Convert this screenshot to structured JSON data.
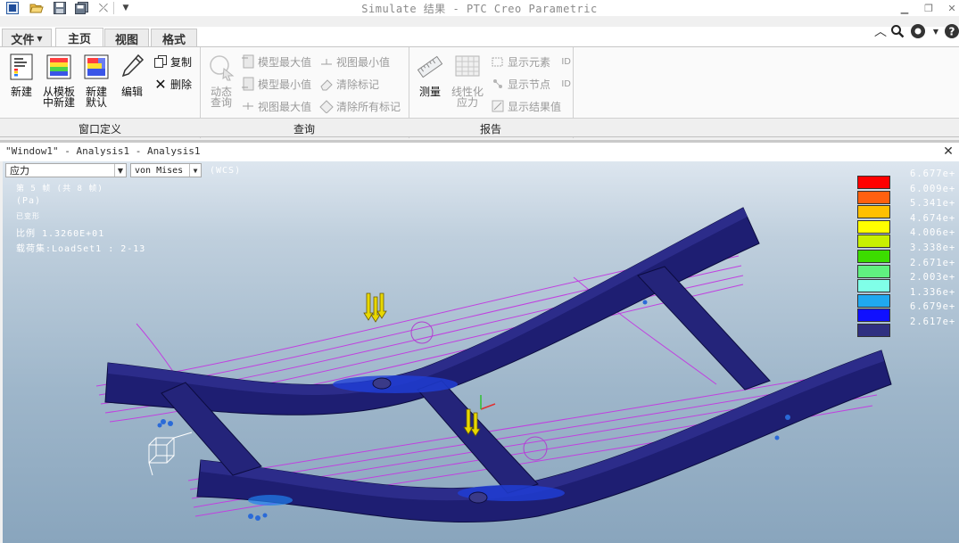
{
  "window": {
    "title": "Simulate 结果 - PTC Creo Parametric"
  },
  "tabs": [
    {
      "label": "文件"
    },
    {
      "label": "主页"
    },
    {
      "label": "视图"
    },
    {
      "label": "格式"
    }
  ],
  "ribbon": {
    "groups": [
      {
        "label": "窗口定义"
      },
      {
        "label": "查询"
      },
      {
        "label": "报告"
      }
    ],
    "window_def": {
      "new_label": "新建",
      "from_template_line1": "从模板",
      "from_template_line2": "中新建",
      "new_default_line1": "新建",
      "new_default_line2": "默认",
      "edit_label": "编辑",
      "copy_label": "复制",
      "delete_label": "删除"
    },
    "query": {
      "dynamic_line1": "动态",
      "dynamic_line2": "查询",
      "model_max": "模型最大值",
      "model_min": "模型最小值",
      "view_max": "视图最大值",
      "view_min": "视图最小值",
      "clear_mark": "清除标记",
      "clear_all_marks": "清除所有标记"
    },
    "report": {
      "measure_label": "测量",
      "linearize_line1": "线性化",
      "linearize_line2": "应力",
      "show_element": "显示元素",
      "show_node": "显示节点",
      "show_result": "显示结果值",
      "id_label": "ID"
    }
  },
  "analysis_window": {
    "title": "\"Window1\" - Analysis1 - Analysis1",
    "quantity_select": "应力",
    "component_select": "von Mises",
    "coord_sys": "(WCS)",
    "info_lines": [
      "第 5 帧 (共 8 帧)",
      "(Pa)",
      "已变形",
      "比例   1.3260E+01",
      "载荷集:LoadSet1 :  2-13"
    ]
  },
  "legend": {
    "values": [
      "6.677e+",
      "6.009e+",
      "5.341e+",
      "4.674e+",
      "4.006e+",
      "3.338e+",
      "2.671e+",
      "2.003e+",
      "1.336e+",
      "6.679e+",
      "2.617e+"
    ],
    "colors": [
      "#ff0000",
      "#ff6010",
      "#ffc000",
      "#ffff00",
      "#c8f000",
      "#3cdc00",
      "#60f080",
      "#80ffe8",
      "#20a8f0",
      "#1010ff",
      "#303080"
    ]
  }
}
